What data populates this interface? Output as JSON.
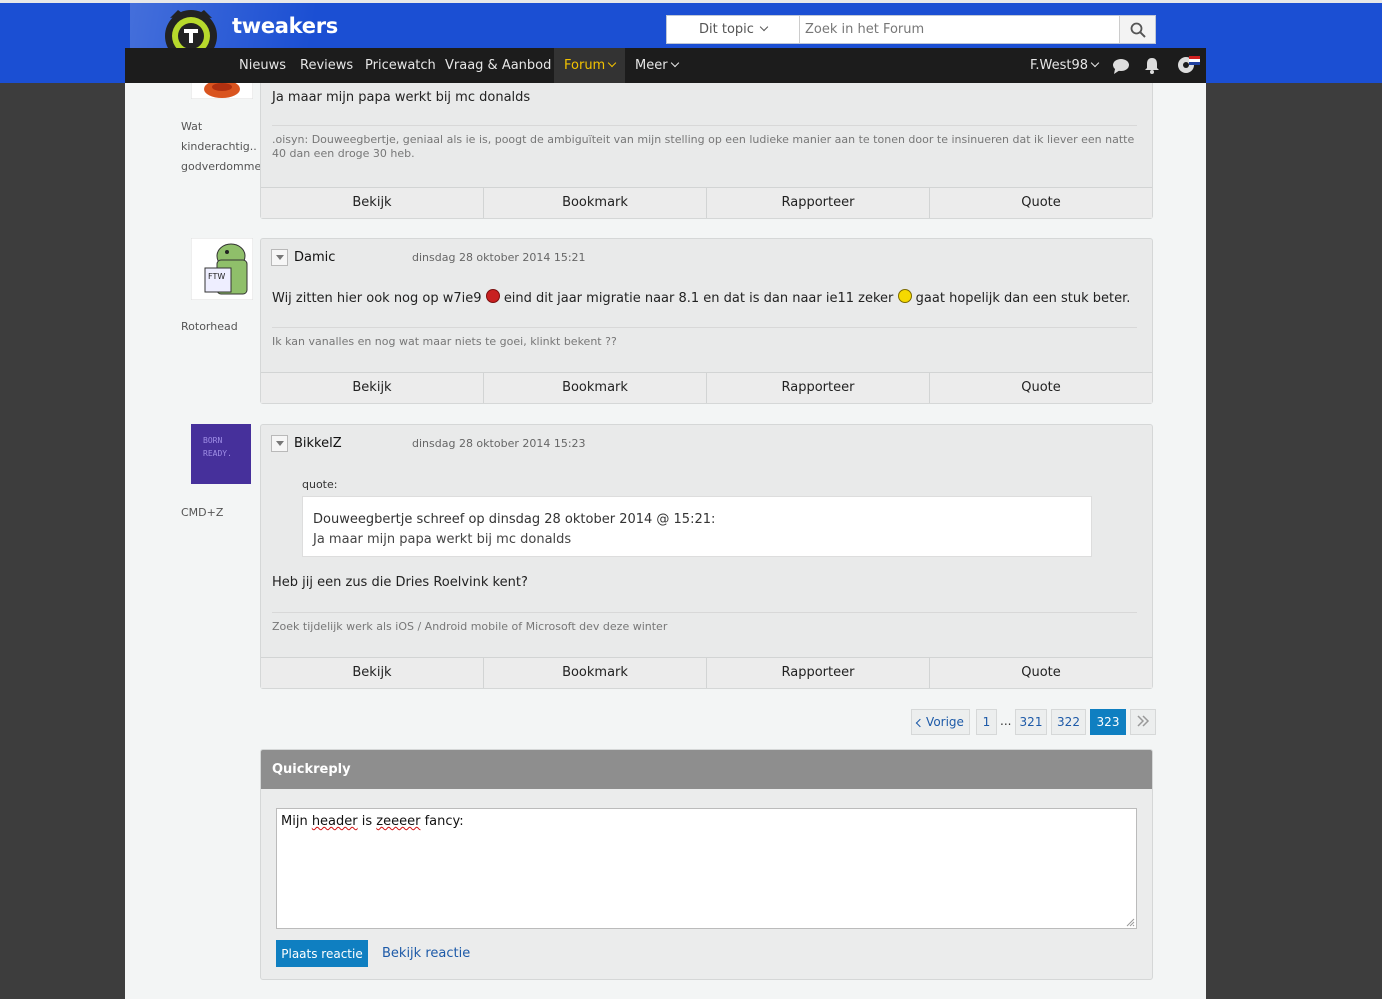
{
  "header": {
    "logo_text": "tweakers",
    "search_scope": "Dit topic",
    "search_placeholder": "Zoek in het Forum"
  },
  "nav": {
    "items": [
      "Nieuws",
      "Reviews",
      "Pricewatch",
      "Vraag & Aanbod",
      "Forum",
      "Meer"
    ],
    "active": "Forum",
    "user": "F.West98"
  },
  "posts": [
    {
      "author_label": "Wat kinderachtig.. godverdomme",
      "author_lines": [
        "Wat",
        "kinderachtig..",
        "godverdomme"
      ],
      "message": "Ja maar mijn papa werkt bij mc donalds",
      "signature": ".oisyn: Douweegbertje, geniaal als ie is, poogt de ambiguïteit van mijn stelling op een ludieke manier aan te tonen door te insinueren dat ik liever een natte 40 dan een droge 30 heb."
    },
    {
      "author": "Damic",
      "user_title": "Rotorhead",
      "date": "dinsdag 28 oktober 2014 15:21",
      "message_part1": "Wij zitten hier ook nog op w7ie9",
      "message_part2": "eind dit jaar migratie naar 8.1 en dat is dan naar ie11 zeker",
      "message_part3": "gaat hopelijk dan een stuk beter.",
      "signature": "Ik kan vanalles en nog wat maar niets te goei, klinkt bekent ??"
    },
    {
      "author": "BikkelZ",
      "user_title": "CMD+Z",
      "date": "dinsdag 28 oktober 2014 15:23",
      "quote_label": "quote:",
      "quote_header": "Douweegbertje schreef op dinsdag 28 oktober 2014 @ 15:21:",
      "quote_text": "Ja maar mijn papa werkt bij mc donalds",
      "message": "Heb jij een zus die Dries Roelvink kent?",
      "signature": "Zoek tijdelijk werk als iOS / Android mobile of Microsoft dev deze winter",
      "avatar_text": [
        "BORN",
        "READY."
      ]
    }
  ],
  "post_actions": [
    "Bekijk",
    "Bookmark",
    "Rapporteer",
    "Quote"
  ],
  "pagination": {
    "prev": "Vorige",
    "first": "1",
    "ellipsis": "...",
    "pages": [
      "321",
      "322",
      "323"
    ],
    "current": "323"
  },
  "quickreply": {
    "title": "Quickreply",
    "text_before": "Mijn ",
    "text_word1": "header",
    "text_mid": " is ",
    "text_word2": "zeeeer",
    "text_after": " fancy:",
    "submit": "Plaats reactie",
    "preview": "Bekijk reactie"
  },
  "colors": {
    "brand_blue": "#1b4fd3",
    "nav_bg": "#1c1c1c",
    "nav_active": "#f2c200",
    "button_blue": "#0f7fc1",
    "link": "#1d5aa8"
  }
}
